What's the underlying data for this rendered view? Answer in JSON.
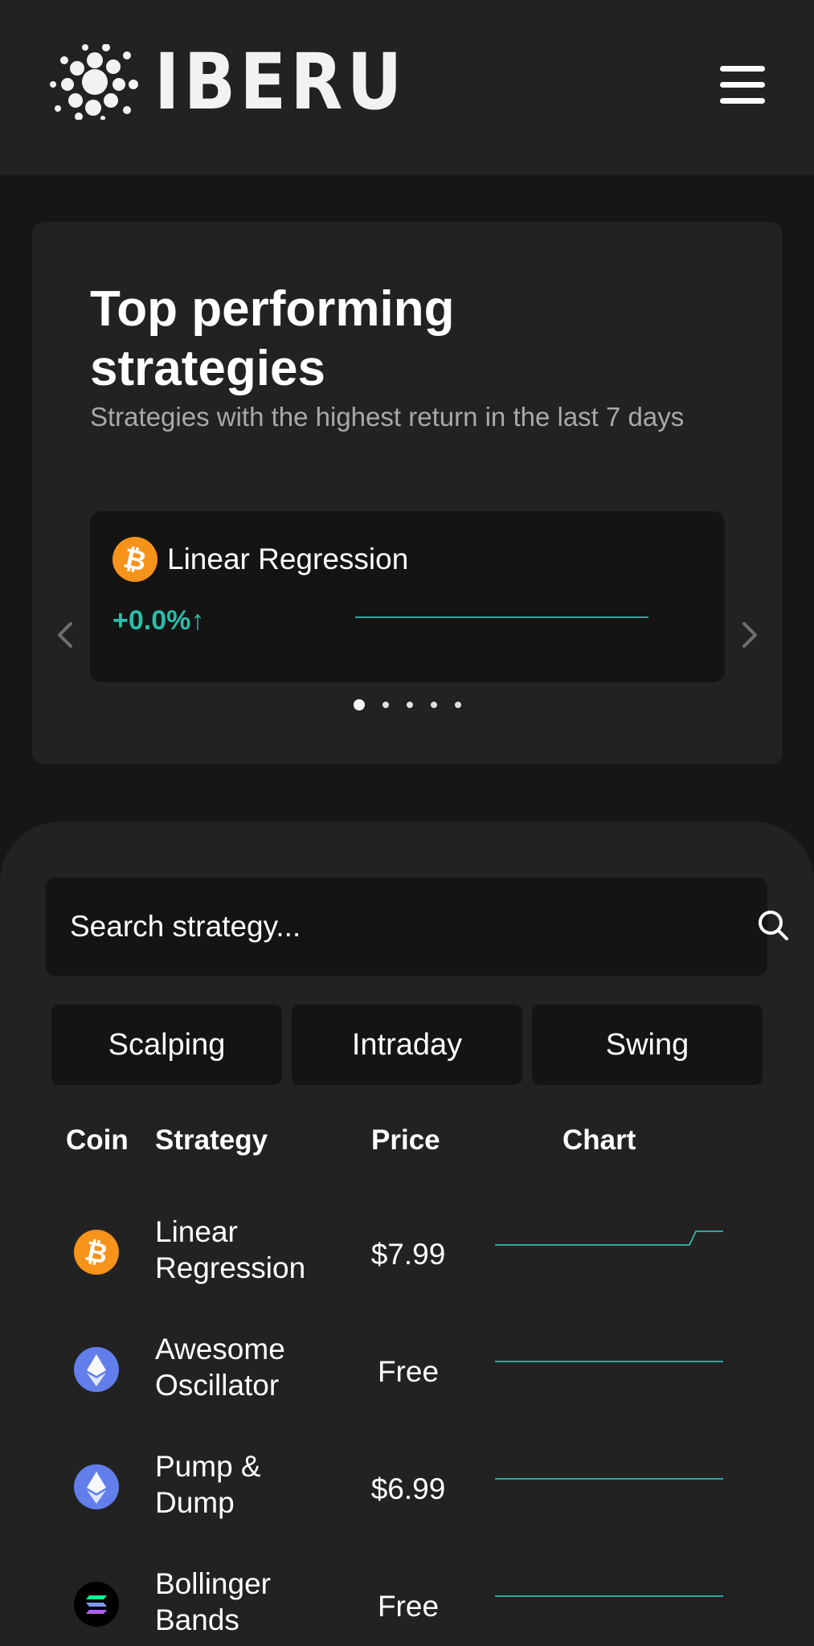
{
  "header": {
    "brand": "IBERU"
  },
  "top": {
    "title": "Top performing strategies",
    "subtitle": "Strategies with the highest return in the last 7 days",
    "slide": {
      "coin": "bitcoin-icon",
      "name": "Linear Regression",
      "return": "+0.0%",
      "return_arrow": "↑"
    },
    "dots_count": 5,
    "active_dot": 0
  },
  "search": {
    "placeholder": "Search strategy..."
  },
  "tabs": [
    "Scalping",
    "Intraday",
    "Swing"
  ],
  "table": {
    "headers": {
      "coin": "Coin",
      "strategy": "Strategy",
      "price": "Price",
      "chart": "Chart"
    },
    "rows": [
      {
        "coin": "bitcoin-icon",
        "strategy": "Linear Regression",
        "price": "$7.99"
      },
      {
        "coin": "ethereum-icon",
        "strategy": "Awesome Oscillator",
        "price": "Free"
      },
      {
        "coin": "ethereum-icon",
        "strategy": "Pump & Dump",
        "price": "$6.99"
      },
      {
        "coin": "solana-icon",
        "strategy": "Bollinger Bands",
        "price": "Free"
      }
    ]
  },
  "colors": {
    "background": "#161616",
    "panel": "#222222",
    "inset": "#141414",
    "accent": "#2bbcab",
    "bitcoin": "#f7931a",
    "ethereum": "#627eea"
  }
}
